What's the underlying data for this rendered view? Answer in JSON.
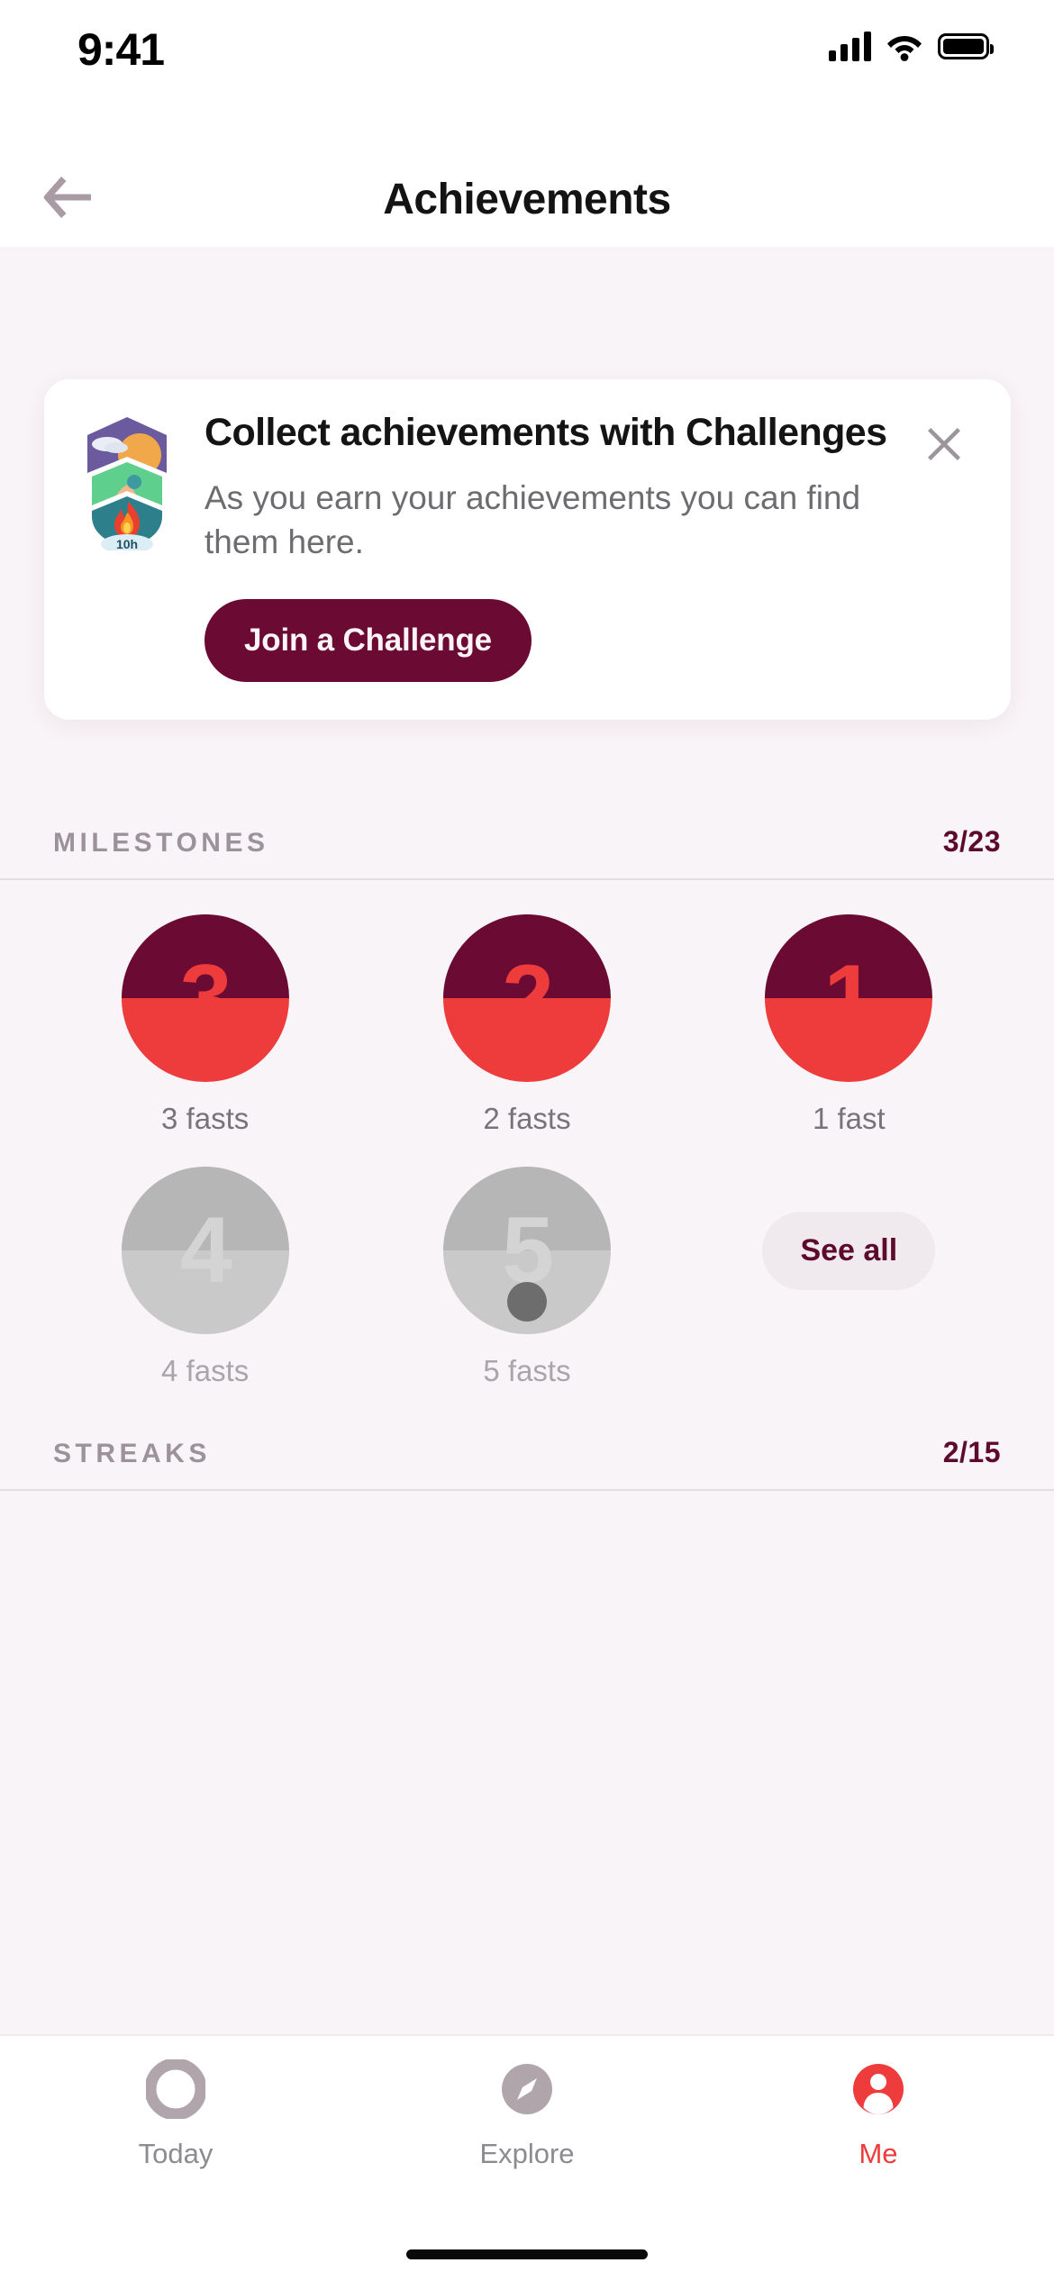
{
  "status_bar": {
    "time": "9:41",
    "cellular_icon": "cellular-bars-icon",
    "wifi_icon": "wifi-icon",
    "battery_icon": "battery-full-icon"
  },
  "nav": {
    "back_icon": "back-arrow-icon",
    "title": "Achievements"
  },
  "promo_card": {
    "badge_icon": "challenge-badge-icon",
    "badge_hours_label": "10h",
    "title": "Collect achievements with Challenges",
    "body": "As you earn your achievements you can find them here.",
    "cta_label": "Join a Challenge",
    "close_icon": "close-icon"
  },
  "milestones": {
    "section_title": "MILESTONES",
    "count": "3/23",
    "see_all_label": "See all",
    "items": [
      {
        "number": "3",
        "label": "3 fasts",
        "state": "earned",
        "has_dot": false
      },
      {
        "number": "2",
        "label": "2 fasts",
        "state": "earned",
        "has_dot": false
      },
      {
        "number": "1",
        "label": "1 fast",
        "state": "earned",
        "has_dot": false
      },
      {
        "number": "4",
        "label": "4 fasts",
        "state": "locked",
        "has_dot": false
      },
      {
        "number": "5",
        "label": "5 fasts",
        "state": "locked",
        "has_dot": true
      }
    ]
  },
  "streaks": {
    "section_title": "STREAKS",
    "count": "2/15"
  },
  "tab_bar": {
    "items": [
      {
        "label": "Today",
        "icon": "today-ring-icon",
        "active": false
      },
      {
        "label": "Explore",
        "icon": "compass-icon",
        "active": false
      },
      {
        "label": "Me",
        "icon": "person-icon",
        "active": true
      }
    ]
  },
  "colors": {
    "brand_maroon": "#6B0B33",
    "accent_red": "#EE3B3B",
    "page_background": "#F9F4F7",
    "locked_gray": "#B6B6B6"
  }
}
